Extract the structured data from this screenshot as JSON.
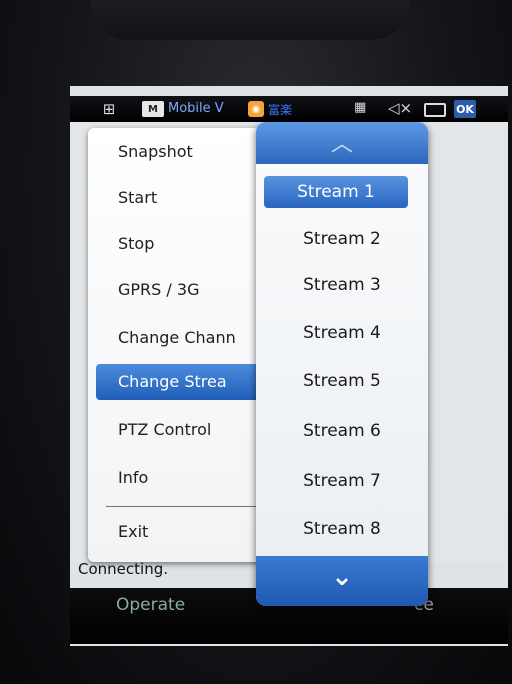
{
  "taskbar": {
    "start_icon": "windows-start-icon",
    "app_title": "Mobile V",
    "app_icon_glyph": "M",
    "app2_text": "富楽",
    "ok_label": "OK"
  },
  "status": {
    "text": "Connecting."
  },
  "softkeys": {
    "left": "Operate",
    "right": "ce"
  },
  "operate_menu": {
    "items": [
      "Snapshot",
      "Start",
      "Stop",
      "GPRS / 3G",
      "Change Chann",
      "Change Strea",
      "PTZ Control",
      "Info",
      "Exit"
    ],
    "selected_item": "Change Strea"
  },
  "stream_menu": {
    "items": [
      "Stream 1",
      "Stream 2",
      "Stream 3",
      "Stream 4",
      "Stream 5",
      "Stream 6",
      "Stream 7",
      "Stream 8"
    ],
    "selected_item": "Stream 1",
    "scroll_up_icon": "chevron-up-icon",
    "scroll_down_icon": "chevron-down-icon"
  },
  "colors": {
    "accent": "#2965c0",
    "menu_bg": "#ffffff",
    "taskbar_bg": "#000000"
  }
}
